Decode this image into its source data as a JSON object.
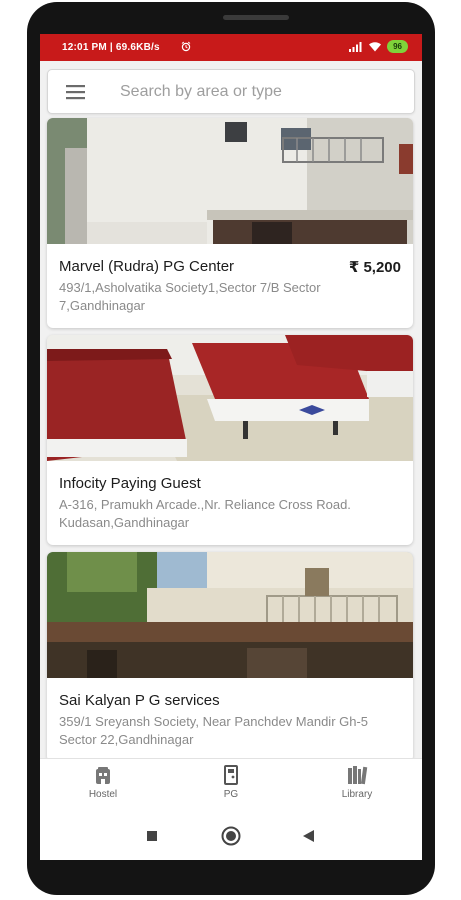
{
  "status_bar": {
    "time_speed": "12:01 PM | 69.6KB/s",
    "battery": "96",
    "bar_color": "#c81a1a"
  },
  "search": {
    "placeholder": "Search by area or type",
    "menu_icon": "hamburger-menu-icon"
  },
  "listings": [
    {
      "name": "Marvel (Rudra) PG Center",
      "price": "₹ 5,200",
      "address": "493/1,Asholvatika Society1,Sector 7/B Sector 7,Gandhinagar"
    },
    {
      "name": "Infocity Paying Guest",
      "price": "",
      "address": "A-316, Pramukh Arcade.,Nr. Reliance Cross Road. Kudasan,Gandhinagar"
    },
    {
      "name": "Sai Kalyan P G services",
      "price": "",
      "address": "359/1 Sreyansh Society, Near Panchdev Mandir Gh-5 Sector 22,Gandhinagar"
    }
  ],
  "bottom_nav": {
    "items": [
      {
        "label": "Hostel",
        "icon": "hostel-building-icon"
      },
      {
        "label": "PG",
        "icon": "pg-door-icon"
      },
      {
        "label": "Library",
        "icon": "library-books-icon"
      }
    ]
  },
  "system_nav": {
    "recents_icon": "square-recents-icon",
    "home_icon": "circle-home-icon",
    "back_icon": "triangle-back-icon"
  }
}
